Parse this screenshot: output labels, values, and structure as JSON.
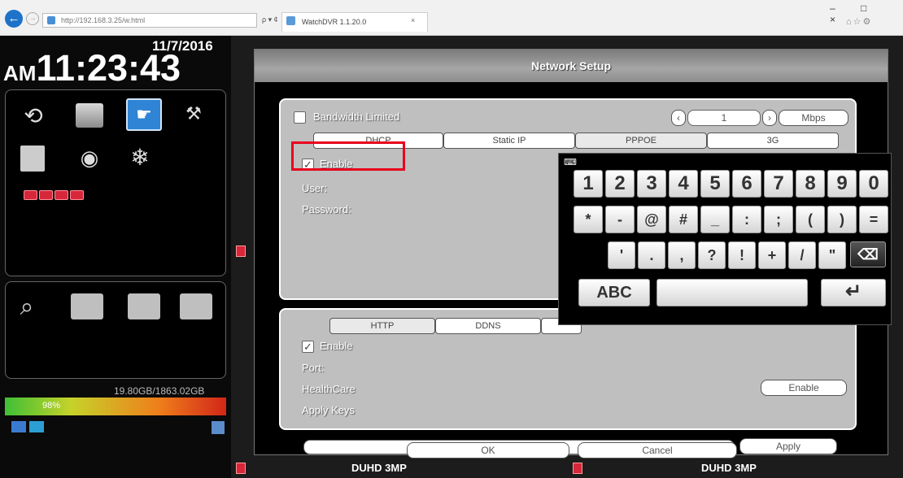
{
  "browser": {
    "url": "http://192.168.3.25/w.html",
    "tab_title": "WatchDVR 1.1.20.0",
    "tab_close": "×",
    "addr_tools": "ρ ▾ ¢",
    "back_glyph": "←",
    "forward_glyph": "→",
    "window_controls": "– □ ×"
  },
  "dvr": {
    "date": "11/7/2016",
    "ampm": "AM",
    "time": "11:23:43",
    "hdd_usage": "19.80GB/1863.02GB",
    "hdd_percent": "98%",
    "hdd_fill": 0.98,
    "menu_icons": [
      "back-icon",
      "folder-icon",
      "hand-setup-icon",
      "tools-icon",
      "search-file-icon",
      "camera-icon",
      "freeze-icon"
    ],
    "view_icons": [
      "search-icon",
      "single-view-icon",
      "full-view-icon",
      "quad-view-icon"
    ],
    "channel_leds": 4,
    "status_left": "DUHD 3MP",
    "status_right": "DUHD 3MP"
  },
  "network": {
    "title": "Network Setup",
    "bandwidth_label": "Bandwidth Limited",
    "bandwidth_checked": false,
    "bandwidth_value": "1",
    "bandwidth_unit": "Mbps",
    "tabs": [
      "DHCP",
      "Static IP",
      "PPPOE",
      "3G"
    ],
    "enable_label": "Enable",
    "user_label": "User:",
    "password_label": "Password:",
    "lower_tabs": [
      "HTTP",
      "DDNS"
    ],
    "lower_enable_label": "Enable",
    "port_label": "Port:",
    "health_label": "HealthCare",
    "health_value": "Enable",
    "apply_keys_label": "Apply Keys",
    "apply_label": "Apply",
    "ok_label": "OK",
    "cancel_label": "Cancel"
  },
  "keyboard": {
    "row1": [
      "1",
      "2",
      "3",
      "4",
      "5",
      "6",
      "7",
      "8",
      "9",
      "0"
    ],
    "row2": [
      "*",
      "-",
      "@",
      "#",
      "_",
      ":",
      ";",
      "(",
      ")",
      "="
    ],
    "row3": [
      "'",
      ".",
      ",",
      "?",
      "!",
      "+",
      "/",
      "\""
    ],
    "abc_label": "ABC",
    "backspace_glyph": "⌫",
    "enter_glyph": "↵"
  },
  "colors": {
    "highlight": "#e8001d",
    "accent": "#2f84d6"
  }
}
